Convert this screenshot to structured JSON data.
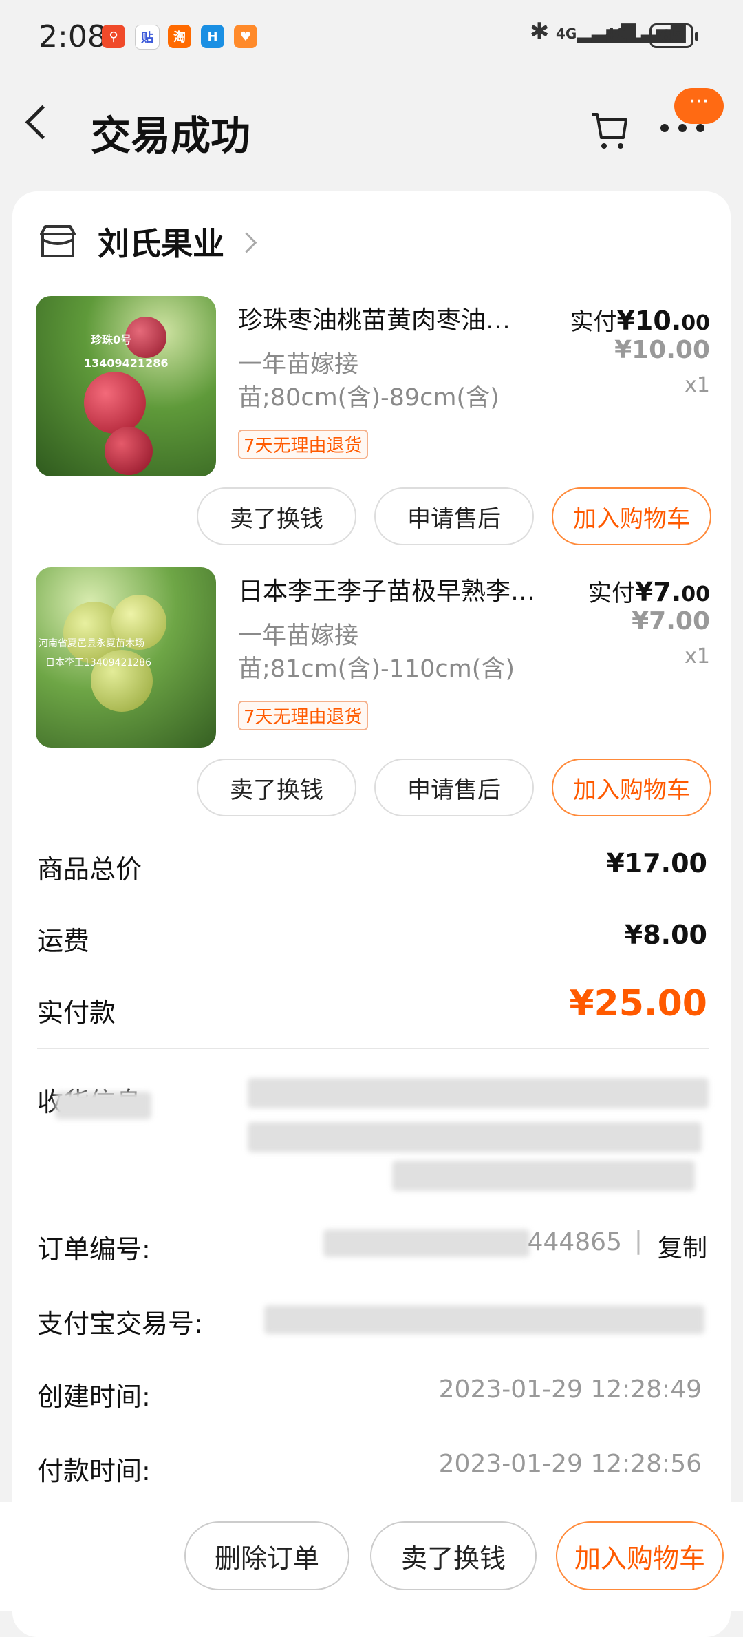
{
  "status_bar": {
    "time": "2:08",
    "network1": "4G",
    "network2": "4G",
    "battery": "65"
  },
  "header": {
    "title": "交易成功",
    "more_badge": "···"
  },
  "shop": {
    "name": "刘氏果业"
  },
  "products": [
    {
      "title": "珍珠枣油桃苗黄肉枣油…",
      "spec": "一年苗嫁接苗;80cm(含)-89cm(含)",
      "tag": "7天无理由退货",
      "pay_label": "实付",
      "pay_int": "¥10.",
      "pay_dec": "00",
      "orig_price": "¥10.00",
      "qty": "x1",
      "thumb_text1": "珍珠0号",
      "thumb_text2": "13409421286",
      "buttons": [
        "卖了换钱",
        "申请售后",
        "加入购物车"
      ]
    },
    {
      "title": "日本李王李子苗极早熟李…",
      "spec": "一年苗嫁接苗;81cm(含)-110cm(含)",
      "tag": "7天无理由退货",
      "pay_label": "实付",
      "pay_int": "¥7.",
      "pay_dec": "00",
      "orig_price": "¥7.00",
      "qty": "x1",
      "thumb_text1": "河南省夏邑县永夏苗木场",
      "thumb_text2": "日本李王13409421286",
      "buttons": [
        "卖了换钱",
        "申请售后",
        "加入购物车"
      ]
    }
  ],
  "summary": {
    "subtotal_label": "商品总价",
    "subtotal": "¥17.00",
    "shipping_label": "运费",
    "shipping": "¥8.00",
    "total_label": "实付款",
    "total": "¥25.00"
  },
  "order_info": {
    "address_label": "收货信息",
    "order_no_label": "订单编号:",
    "order_no_visible": "444865",
    "copy_label": "复制",
    "alipay_label": "支付宝交易号:",
    "created_label": "创建时间:",
    "created": "2023-01-29 12:28:49",
    "paid_label": "付款时间:",
    "paid": "2023-01-29 12:28:56"
  },
  "bottom_bar": {
    "delete": "删除订单",
    "sell": "卖了换钱",
    "add_cart": "加入购物车"
  },
  "colors": {
    "accent": "#ff5a00",
    "badge": "#ff6a13",
    "background": "#f2f2f2"
  }
}
